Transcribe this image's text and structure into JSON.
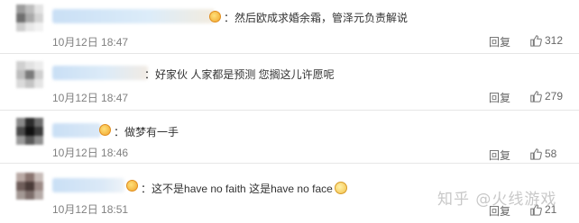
{
  "comments": [
    {
      "text": "然后欧成求婚余霜，管泽元负责解说",
      "time": "10月12日 18:47",
      "reply_label": "回复",
      "likes": "312"
    },
    {
      "text": "好家伙 人家都是预测 您搁这儿许愿呢",
      "time": "10月12日 18:47",
      "reply_label": "回复",
      "likes": "279"
    },
    {
      "text": "做梦有一手",
      "time": "10月12日 18:46",
      "reply_label": "回复",
      "likes": "58"
    },
    {
      "text": "这不是have no faith 这是have no face",
      "time": "10月12日 18:51",
      "reply_label": "回复",
      "likes": "21"
    }
  ],
  "watermark": "知乎 @火线游戏",
  "icons": {
    "like": "thumbs-up-icon",
    "emoji": "smiley-emoji-icon"
  },
  "colors": {
    "text": "#333333",
    "meta": "#808080",
    "divider": "#e6e6e6",
    "watermark": "#c8c8c8"
  }
}
